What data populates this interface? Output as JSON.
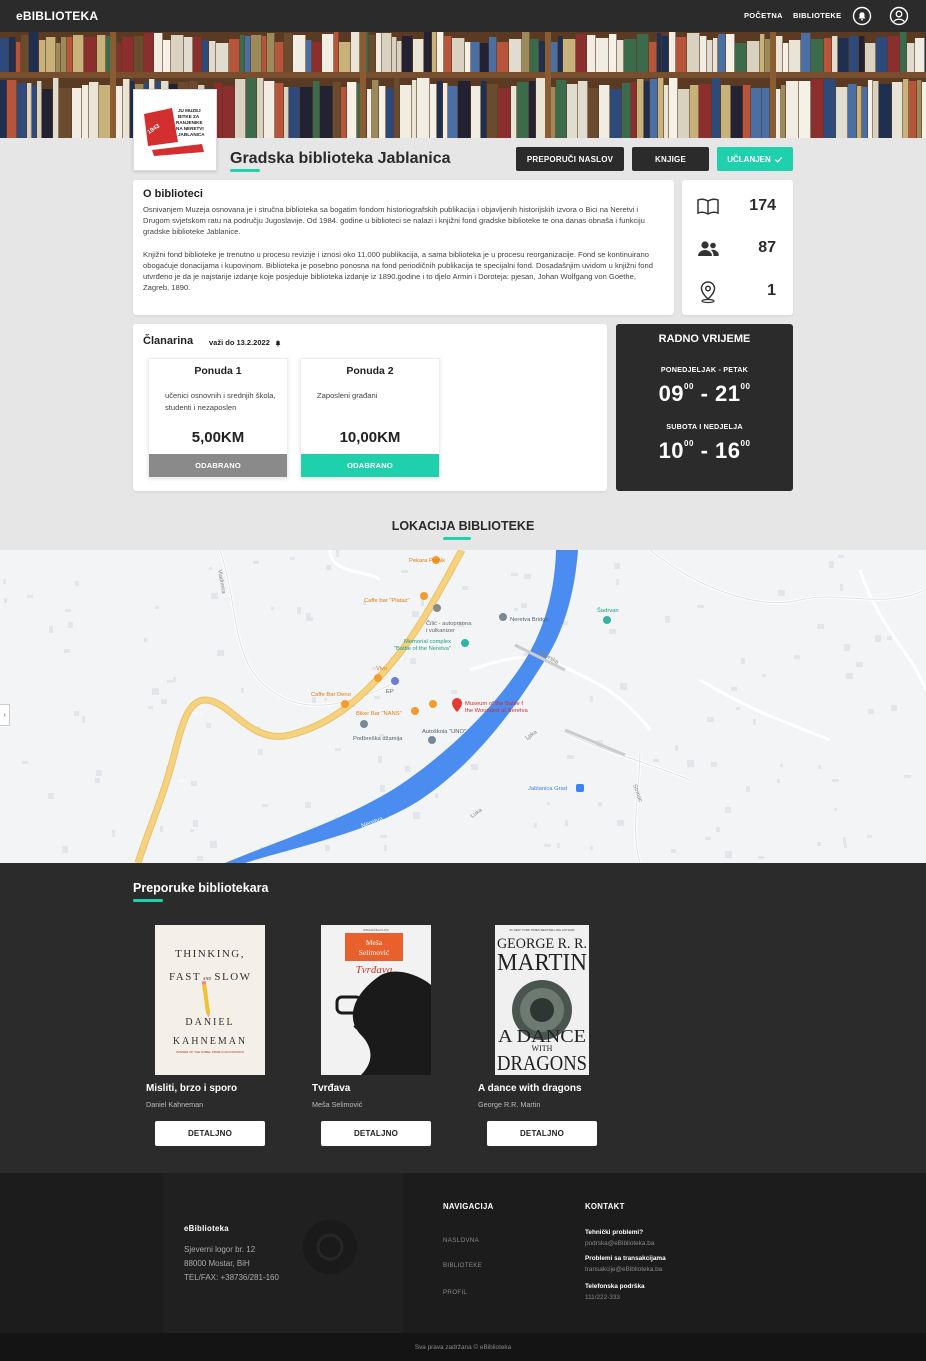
{
  "navbar": {
    "brand": "eBIBLIOTEKA",
    "links": [
      "POČETNA",
      "BIBLIOTEKE"
    ]
  },
  "library": {
    "name": "Gradska biblioteka Jablanica",
    "logo_text": [
      "JU MUZEJ",
      "BITKE ZA",
      "RANJENIKE",
      "NA NERETVI",
      "JABLANICA"
    ]
  },
  "actions": {
    "recommend": "PREPORUČI NASLOV",
    "books": "KNJIGE",
    "member": "UČLANJEN"
  },
  "about": {
    "title": "O biblioteci",
    "p1": "Osnivanjem Muzeja osnovana je i stručna biblioteka sa bogatim fondom historiografskih publikacija i objavljenih historijskih izvora o Bici na Neretvi i Drugom svjetskom ratu na području Jugoslavije. Od 1984. godine u biblioteci se nalazi i knjižni fond gradske biblioteke te ona danas obnaša i funkciju gradske biblioteke Jablanice.",
    "p2": "Knjižni fond biblioteke je trenutno u procesu revizije i iznosi oko 11.000 publikacija, a sama biblioteka je u procesu reorganizacije. Fond se kontinuirano obogaćuje donacijama i kupovinom. Biblioteka je posebno ponosna na fond periodičnih publikacija te specijalni fond. Dosadašnjim uvidom u knjižni fond utvrđeno je da je najstarije izdanje koje posjeduje biblioteka izdanje iz 1890.godine i to djelo Armin i Doroteja: pjesan, Johan Wolfgang von Goethe, Zagreb, 1890."
  },
  "stats": {
    "books": "174",
    "members": "87",
    "locations": "1"
  },
  "membership": {
    "title": "Članarina",
    "valid": "važi do 13.2.2022",
    "offers": [
      {
        "name": "Ponuda 1",
        "desc": "učenici osnovnih i srednjih škola, studenti i nezaposlen",
        "price": "5,00KM",
        "button": "ODABRANO",
        "color": "#8a8a8a"
      },
      {
        "name": "Ponuda 2",
        "desc": "Zaposleni građani",
        "price": "10,00KM",
        "button": "ODABRANO",
        "color": "#1ed1ac"
      }
    ]
  },
  "hours": {
    "title": "RADNO VRIJEME",
    "weekday_label": "PONEDJELJAK - PETAK",
    "weekday_open": "09",
    "weekday_close": "21",
    "weekend_label": "SUBOTA I NEDJELJA",
    "weekend_open": "10",
    "weekend_close": "16",
    "minutes": "00",
    "dash": "-"
  },
  "location": {
    "title": "LOKACIJA BIBLIOTEKE",
    "map_labels": {
      "pekara": "Pekara Putnik",
      "plataz": "Caffe bar \"Plataz\"",
      "cilic": "Čilić - autopraona",
      "cilic2": "i vulkanizer",
      "memorial": "Memorial complex",
      "memorial2": "\"Battle of the Neretva\"",
      "bridge": "Neretva Bridge",
      "sadrvan": "Šadrvan",
      "vivo": "Vivo",
      "ep": "EP",
      "deno": "Caffe Bar Deno",
      "nans": "Biker Bar \"NANS\"",
      "museum": "Museum of the Battle f",
      "museum2": "the Wounded at Neretva",
      "dzamija": "Podbreška džamija",
      "autoskola": "Autoškola \"UNO\"",
      "grad": "Jablanica Grad",
      "river": "Neretva",
      "road1": "M17",
      "road2": "M17",
      "luka1": "Luka",
      "luka2": "Luka",
      "bikerski": "Bikerska",
      "vladimira": "Vladimira",
      "street3": "Strmac"
    }
  },
  "recommendations": {
    "title": "Preporuke bibliotekara",
    "books": [
      {
        "title": "Misliti, brzo i sporo",
        "author": "Daniel Kahneman",
        "button": "DETALJNO",
        "cover": {
          "l1": "THINKING,",
          "l2": "FAST",
          "and": "AND",
          "l3": "SLOW",
          "a1": "DANIEL",
          "a2": "KAHNEMAN",
          "tagline": "WINNER OF THE NOBEL PRIZE IN ECONOMICS"
        }
      },
      {
        "title": "Tvrđava",
        "author": "Meša Selimović",
        "button": "DETALJNO",
        "cover": {
          "top": "IZDAVAČKA KUĆA",
          "a1": "Meša",
          "a2": "Selimović",
          "t": "Tvrđava"
        }
      },
      {
        "title": "A dance with dragons",
        "author": "George R.R. Martin",
        "button": "DETALJNO",
        "cover": {
          "top": "#1 NEW YORK TIMES BESTSELLING AUTHOR",
          "a1": "GEORGE R. R.",
          "a2": "MARTIN",
          "t1": "A DANCE",
          "t2": "WITH",
          "t3": "DRAGONS"
        }
      }
    ]
  },
  "footer": {
    "brand": "eBiblioteka",
    "address1": "Sjeverni logor br. 12",
    "address2": "88000 Mostar, BiH",
    "phone": "TEL/FAX: +38736/281-160",
    "nav_title": "NAVIGACIJA",
    "nav_links": [
      "NASLOVNA",
      "BIBLIOTEKE",
      "PROFIL"
    ],
    "contact_title": "KONTAKT",
    "tech_label": "Tehnički problemi?",
    "tech_email": "podrska@eBiblioteka.ba",
    "trans_label": "Problemi sa transakcijama",
    "trans_email": "transakcije@eBiblioteka.ba",
    "phone_label": "Telefonska podrška",
    "phone_value": "111/222-333",
    "copyright": "Sva prava zadržana © eBiblioteka"
  },
  "colors": {
    "accent": "#1ed1ac",
    "dark": "#2b2b2b",
    "selected_gray": "#8a8a8a",
    "river": "#4a8cf0",
    "road": "#f6d27e"
  }
}
